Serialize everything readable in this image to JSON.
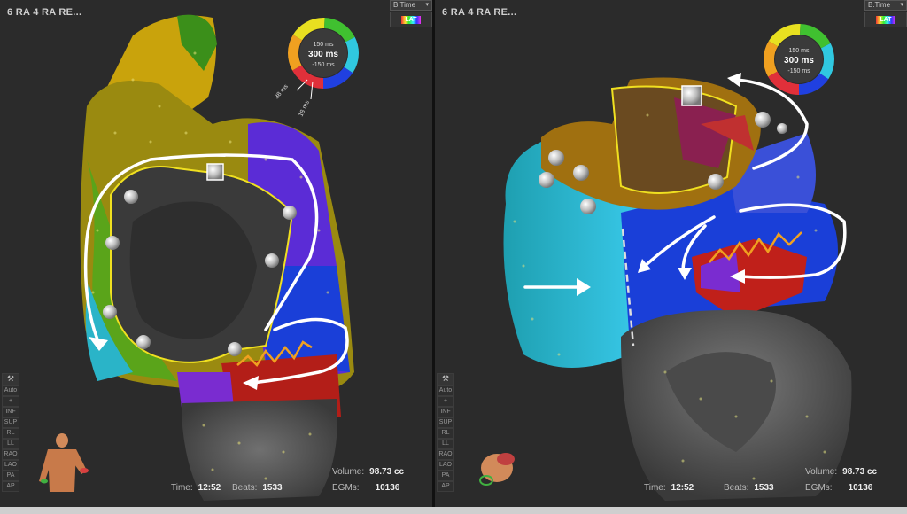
{
  "left": {
    "title": "6 RA 4 RA RE...",
    "mode_label": "B.Time",
    "mode_btn": "LAT",
    "legend": {
      "top": "150 ms",
      "center": "300 ms",
      "bottom": "-150 ms",
      "tick_a": "38 ms",
      "tick_b": "18 ms"
    },
    "sidebar": [
      "Auto",
      "+",
      "INF",
      "SUP",
      "RL",
      "LL",
      "RAO",
      "LAO",
      "PA",
      "AP"
    ],
    "volume_label": "Volume:",
    "volume_value": "98.73 cc",
    "time_label": "Time:",
    "time_value": "12:52",
    "beats_label": "Beats:",
    "beats_value": "1533",
    "egms_label": "EGMs:",
    "egms_value": "10136"
  },
  "right": {
    "title": "6 RA 4 RA RE...",
    "mode_label": "B.Time",
    "mode_btn": "LAT",
    "legend": {
      "top": "150 ms",
      "center": "300 ms",
      "bottom": "-150 ms"
    },
    "sidebar": [
      "Auto",
      "+",
      "INF",
      "SUP",
      "RL",
      "LL",
      "RAO",
      "LAO",
      "PA",
      "AP"
    ],
    "volume_label": "Volume:",
    "volume_value": "98.73 cc",
    "time_label": "Time:",
    "time_value": "12:52",
    "beats_label": "Beats:",
    "beats_value": "1533",
    "egms_label": "EGMs:",
    "egms_value": "10136"
  },
  "colors": {
    "yellow_border": "#f0e020",
    "arrow": "#ffffff",
    "lat_red": "#c0201a",
    "lat_blue": "#1a3fd8"
  }
}
